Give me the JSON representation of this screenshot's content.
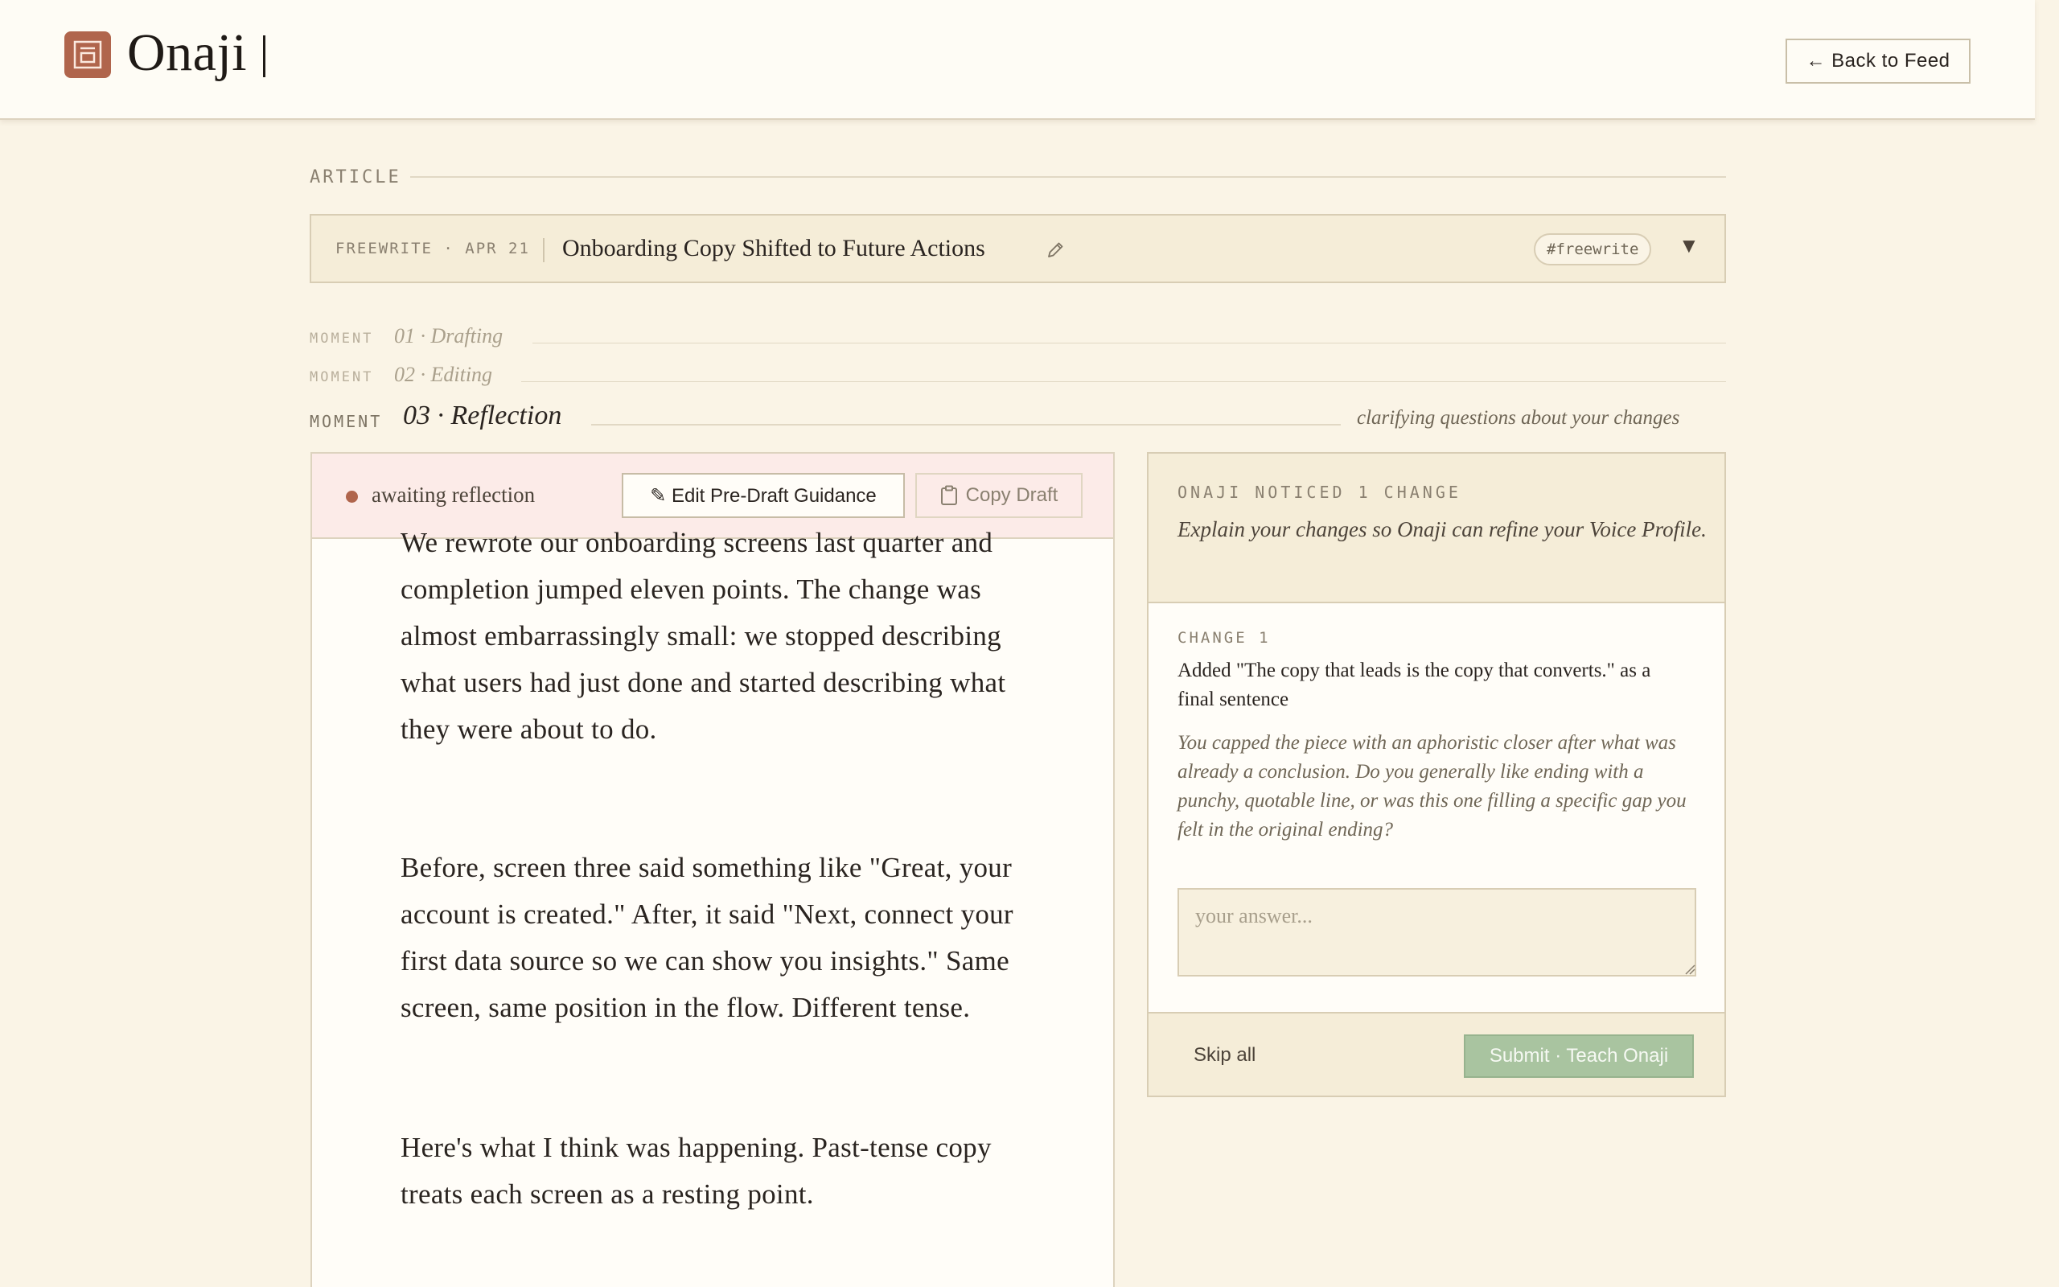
{
  "app": {
    "name": "Onaji",
    "back_label": "← Back to Feed"
  },
  "article": {
    "section_label": "ARTICLE",
    "meta": "FREEWRITE · APR 21",
    "title": "Onboarding Copy Shifted to Future Actions",
    "tag": "#freewrite",
    "caret": "▼"
  },
  "moments": [
    {
      "label": "MOMENT",
      "name": "01 · Drafting"
    },
    {
      "label": "MOMENT",
      "name": "02 · Editing"
    },
    {
      "label": "MOMENT",
      "name": "03 · Reflection",
      "note": "clarifying questions about your changes"
    }
  ],
  "draft": {
    "status": "awaiting reflection",
    "guidance_label": "✎ Edit Pre-Draft Guidance",
    "copy_label": "Copy Draft",
    "paragraphs": [
      "We rewrote our onboarding screens last quarter and completion jumped eleven points. The change was almost embarrassingly small: we stopped describing what users had just done and started describing what they were about to do.",
      "Before, screen three said something like \"Great, your account is created.\" After, it said \"Next, connect your first data source so we can show you insights.\" Same screen, same position in the flow. Different tense.",
      "Here's what I think was happening. Past-tense copy treats each screen as a resting point."
    ]
  },
  "reflection": {
    "count_label": "ONAJI NOTICED 1 CHANGE",
    "intro": "Explain your changes so Onaji can refine your Voice Profile.",
    "changes": [
      {
        "label": "CHANGE 1",
        "description": "Added \"The copy that leads is the copy that converts.\" as a final sentence",
        "question": "You capped the piece with an aphoristic closer after what was already a conclusion. Do you generally like ending with a punchy, quotable line, or was this one filling a specific gap you felt in the original ending?",
        "answer_value": "",
        "answer_placeholder": "your answer..."
      }
    ],
    "skip_label": "Skip all",
    "submit_label": "Submit · Teach Onaji"
  }
}
